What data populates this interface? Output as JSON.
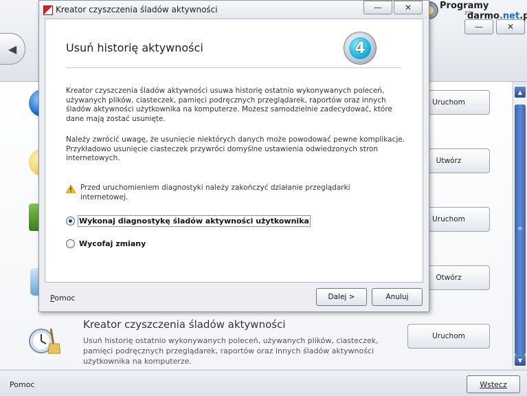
{
  "main": {
    "back_icon": "left-arrow-icon",
    "window_controls": {
      "minimize": "—",
      "close": "✕"
    },
    "brand": {
      "line1": "Programy",
      "za": "za",
      "line2_a": "darmo",
      "line2_b": ".net",
      "line2_c": ".pl"
    },
    "actions": [
      {
        "label": "Uruchom"
      },
      {
        "label": "Utwórz"
      },
      {
        "label": "Uruchom"
      },
      {
        "label": "Otwórz"
      }
    ],
    "item5": {
      "title": "Kreator czyszczenia śladów aktywności",
      "description": "Usuń historię ostatnio wykonywanych poleceń, używanych plików, ciasteczek, pamięci podręcznych przeglądarek, raportów oraz innych śladów aktywności użytkownika na komputerze.",
      "action": "Uruchom"
    },
    "footer": {
      "help": "Pomoc",
      "exit": "Wstecz"
    },
    "scrollbar": {
      "grip": "≡"
    }
  },
  "dialog": {
    "title": "Kreator czyszczenia śladów aktywności",
    "controls": {
      "minimize": "—",
      "close": "✕"
    },
    "heading": "Usuń historię aktywności",
    "step": "4",
    "para1": "Kreator czyszczenia śladów aktywności usuwa historię ostatnio wykonywanych poleceń, używanych plików, ciasteczek, pamięci podręcznych przeglądarek, raportów oraz innych śladów aktywności użytkownika na komputerze. Możesz samodzielnie zadecydować, które dane mają zostać usunięte.",
    "para2": "Należy zwrócić uwagę, że usunięcie niektórych danych może powodować pewne komplikacje. Przykładowo usunięcie ciasteczek przywróci domyślne ustawienia odwiedzonych stron internetowych.",
    "warning": "Przed uruchomieniem diagnostyki należy zakończyć działanie przeglądarki internetowej.",
    "options": [
      {
        "label": "Wykonaj diagnostykę śladów aktywności użytkownika",
        "checked": true
      },
      {
        "label": "Wycofaj zmiany",
        "checked": false
      }
    ],
    "help": "Pomoc",
    "next": "Dalej >",
    "cancel": "Anuluj"
  }
}
